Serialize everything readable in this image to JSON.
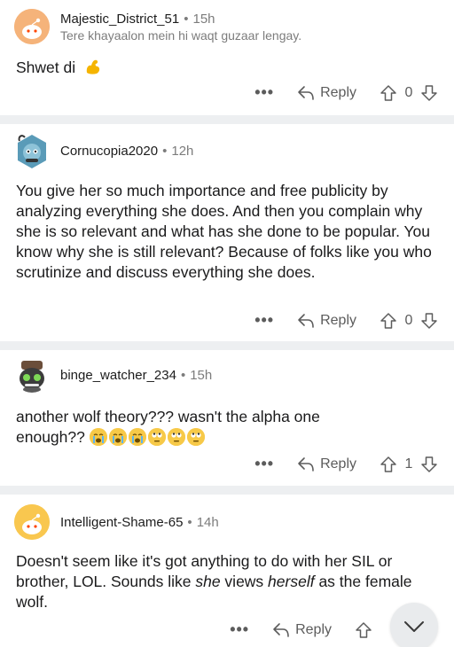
{
  "comments": [
    {
      "user": "Majestic_District_51",
      "age": "15h",
      "flair": "Tere khayaalon mein hi waqt guzaar lengay.",
      "body": "Shwet di",
      "body_emoji": "flexed-biceps",
      "reply_label": "Reply",
      "score": "0"
    },
    {
      "user": "Cornucopia2020",
      "age": "12h",
      "body": "You give her so much importance and free publicity by analyzing everything she does. And then you complain why she is so relevant and what has she done to be popular. You know why she is still relevant? Because of folks like you who scrutinize and discuss everything she does.",
      "reply_label": "Reply",
      "score": "0"
    },
    {
      "user": "binge_watcher_234",
      "age": "15h",
      "body_line1": "another wolf theory??? wasn't the alpha one",
      "body_line2": "enough??",
      "body_emojis": [
        "loudly-crying-face",
        "loudly-crying-face",
        "loudly-crying-face",
        "face-with-rolling-eyes",
        "face-with-rolling-eyes",
        "face-with-rolling-eyes"
      ],
      "reply_label": "Reply",
      "score": "1"
    },
    {
      "user": "Intelligent-Shame-65",
      "age": "14h",
      "body_a": "Doesn't seem like it's got anything to do with her SIL or brother, LOL. Sounds like ",
      "body_em1": "she",
      "body_b": " views ",
      "body_em2": "herself",
      "body_c": " as the female wolf.",
      "reply_label": "Reply"
    }
  ],
  "dot": "•",
  "more": "•••",
  "icons": {
    "reply": "reply-arrow-icon",
    "upvote": "upvote-arrow-icon",
    "downvote": "downvote-arrow-icon",
    "scroll": "chevron-down-icon"
  },
  "colors": {
    "separator": "#edeff1",
    "meta_text": "#7c7c7c",
    "action_text": "#5c5c5c",
    "snoo_orange": "#f7a24a"
  }
}
